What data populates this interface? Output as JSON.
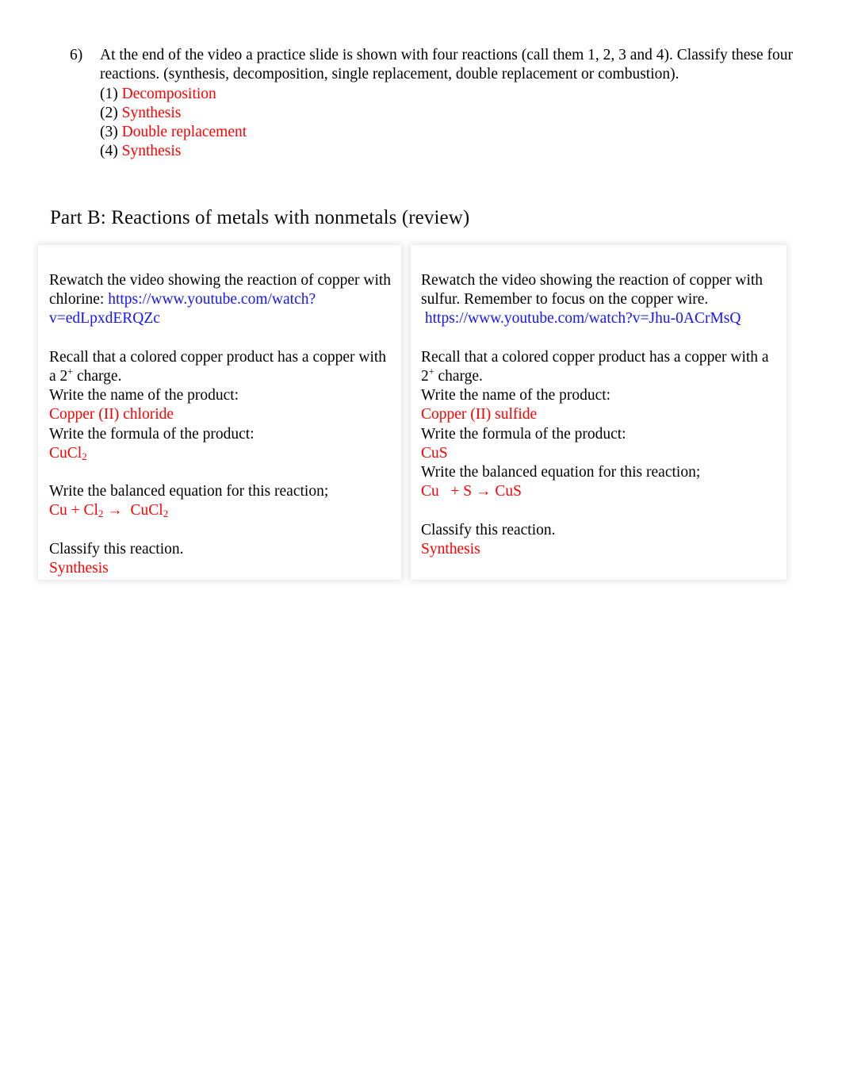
{
  "question": {
    "number": "6)",
    "text": "At the end of the video a practice slide is shown with four reactions (call them 1, 2, 3 and 4). Classify these four reactions. (synthesis, decomposition, single replacement, double replacement or combustion).",
    "answers": [
      {
        "label": "(1)",
        "value": "Decomposition"
      },
      {
        "label": "(2)",
        "value": "Synthesis"
      },
      {
        "label": "(3)",
        "value": "Double replacement"
      },
      {
        "label": "(4)",
        "value": "Synthesis"
      }
    ]
  },
  "part_b": {
    "heading": "Part B: Reactions of metals with nonmetals (review)"
  },
  "colors": {
    "answer_red": "#ff0000",
    "link_blue": "#1414ff",
    "body_text": "#000000"
  },
  "table": {
    "left": {
      "intro_prefix": "Rewatch the video showing the reaction of copper with chlorine: ",
      "url": "https://www.youtube.com/watch?v=edLpxdERQZc",
      "recall_line1": "Recall that a colored copper product has a copper with a 2",
      "recall_sup": "+",
      "recall_line2": " charge.",
      "prompt_name": "Write the name of the product:",
      "answer_name": "Copper (II) chloride",
      "prompt_formula": "Write the formula of the product:",
      "answer_formula_base": "CuCl",
      "answer_formula_sub": "2",
      "prompt_equation": "Write the balanced equation for this reaction;",
      "equation": {
        "r1": "Cu",
        "plus": " + ",
        "r2_base": "Cl",
        "r2_sub": "2",
        "arrow": " → ",
        "p_base": " CuCl",
        "p_sub": "2"
      },
      "prompt_classify": "Classify this reaction.",
      "answer_classify": "Synthesis"
    },
    "right": {
      "intro_prefix": "Rewatch the video showing the reaction of copper with sulfur. Remember to focus on the copper wire.",
      "url": "https://www.youtube.com/watch?v=Jhu-0ACrMsQ",
      "recall_line1": "Recall that a colored copper product has a copper with a 2",
      "recall_sup": "+",
      "recall_line2": " charge.",
      "prompt_name": "Write the name of the product:",
      "answer_name": "Copper (II) sulfide",
      "prompt_formula": "Write the formula of the product:",
      "answer_formula": "CuS",
      "prompt_equation": "Write the balanced equation for this reaction;",
      "equation_text": "Cu   + S → CuS",
      "prompt_classify": "Classify this reaction.",
      "answer_classify": "Synthesis"
    }
  }
}
